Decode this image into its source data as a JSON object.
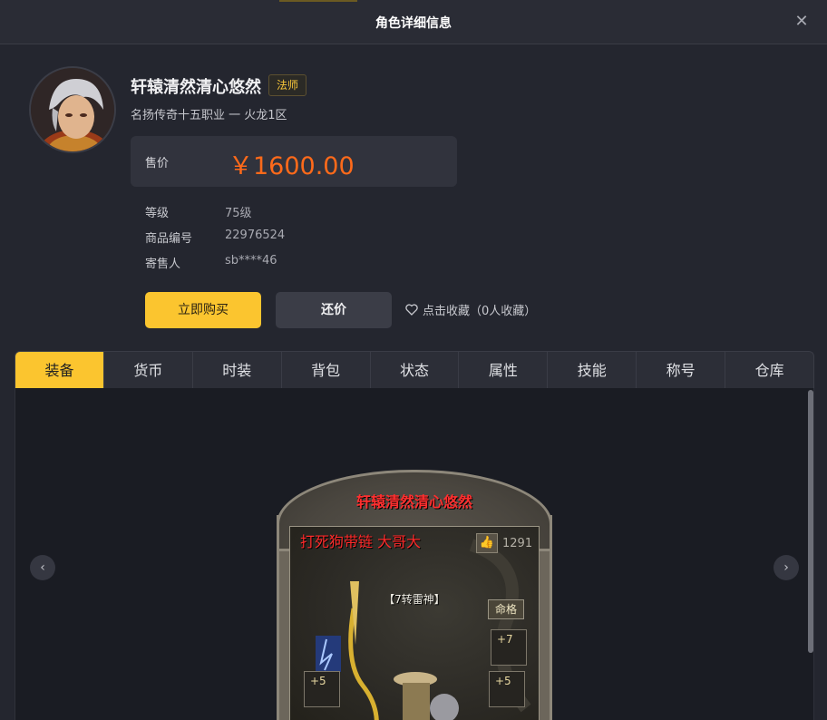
{
  "dialog": {
    "title": "角色详细信息",
    "close_icon": "close-icon"
  },
  "character": {
    "name": "轩辕清然清心悠然",
    "class": "法师",
    "server": "名扬传奇十五职业 一 火龙1区"
  },
  "price": {
    "label": "售价",
    "value": "￥1600.00",
    "color": "#ff6a1a"
  },
  "info": [
    {
      "key": "等级",
      "value": "75级"
    },
    {
      "key": "商品编号",
      "value": "22976524"
    },
    {
      "key": "寄售人",
      "value": "sb****46"
    }
  ],
  "actions": {
    "buy": "立即购买",
    "offer": "还价",
    "favorite": "点击收藏（0人收藏）",
    "favorite_icon": "heart-icon"
  },
  "tabs": [
    "装备",
    "货币",
    "时装",
    "背包",
    "状态",
    "属性",
    "技能",
    "称号",
    "仓库"
  ],
  "active_tab": "装备",
  "accent_color": "#fbc52f",
  "carousel": {
    "prev_icon": "chevron-left-icon",
    "next_icon": "chevron-right-icon"
  },
  "game_screen": {
    "character_name": "轩辕清然清心悠然",
    "guild_title": "打死狗带链 大哥大",
    "likes": "1291",
    "title_tag": "【7转雷神】",
    "fate_button": "命格",
    "slots": [
      "+7",
      "+5",
      "+5"
    ]
  }
}
